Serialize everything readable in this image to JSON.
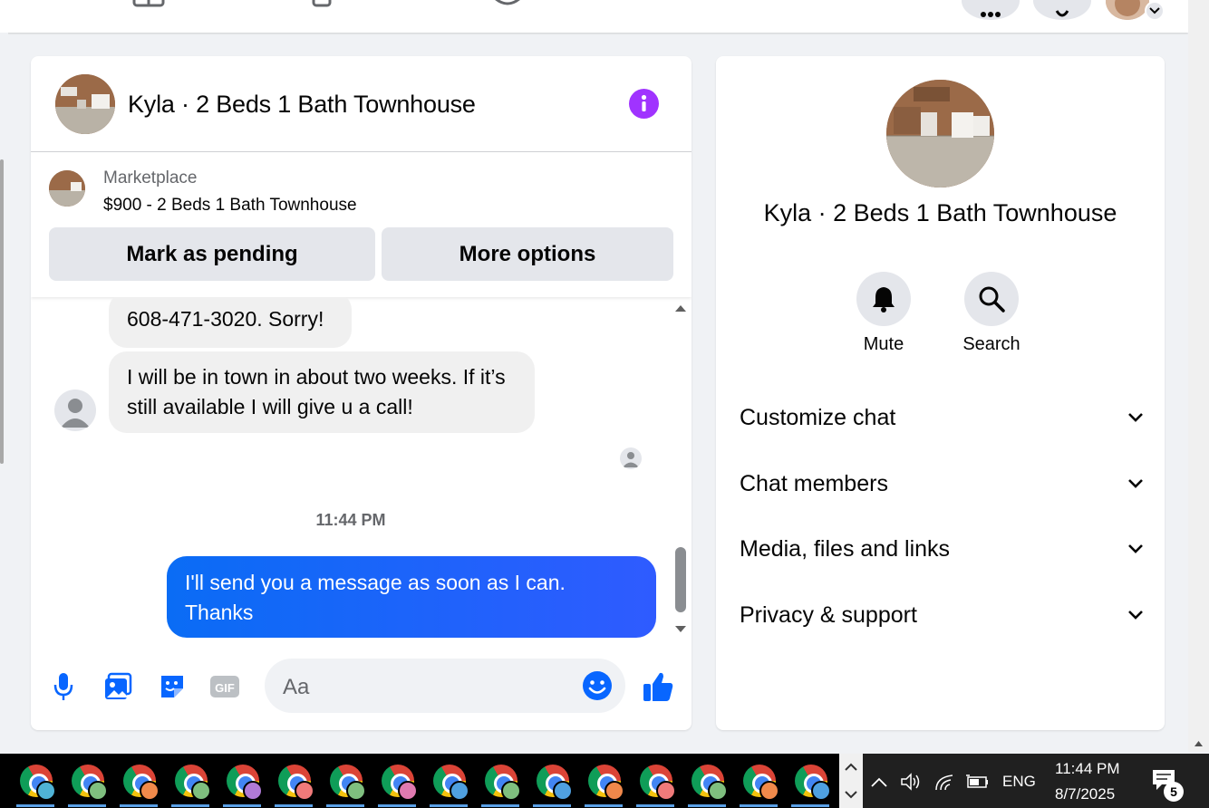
{
  "chat": {
    "title": "Kyla · 2 Beds 1 Bath Townhouse",
    "listing_kicker": "Marketplace",
    "listing_title": "$900 - 2 Beds 1 Bath Townhouse",
    "mark_pending_label": "Mark as pending",
    "more_options_label": "More options",
    "messages": [
      {
        "direction": "in",
        "text": "608-471-3020. Sorry!"
      },
      {
        "direction": "in",
        "text": "I will be in town in about two weeks. If it’s still available I will give u a call!"
      },
      {
        "direction": "out",
        "text": "I'll send you a message as soon as I can. Thanks"
      }
    ],
    "timestamp": "11:44 PM",
    "composer_placeholder": "Aa",
    "gif_label": "GIF"
  },
  "info": {
    "title": "Kyla · 2 Beds 1 Bath Townhouse",
    "mute_label": "Mute",
    "search_label": "Search",
    "sections": [
      "Customize chat",
      "Chat members",
      "Media, files and links",
      "Privacy & support"
    ]
  },
  "taskbar": {
    "app_badges": [
      "#4fb3d6",
      "#7fbf7f",
      "#f08a4b",
      "#7fbf7f",
      "#b07ad6",
      "#f07a7a",
      "#7fbf7f",
      "#e07ab0",
      "#4fa0e0",
      "#7fbf7f",
      "#4fa0e0",
      "#f0884b",
      "#f07a7a",
      "#7fbf7f",
      "#f08a4b",
      "#4fa0e0"
    ],
    "language": "ENG",
    "time": "11:44 PM",
    "date": "8/7/2025",
    "notification_count": "5"
  },
  "colors": {
    "messenger_blue": "#0a6cf5",
    "info_purple": "#a033ff",
    "background": "#f0f2f5"
  }
}
